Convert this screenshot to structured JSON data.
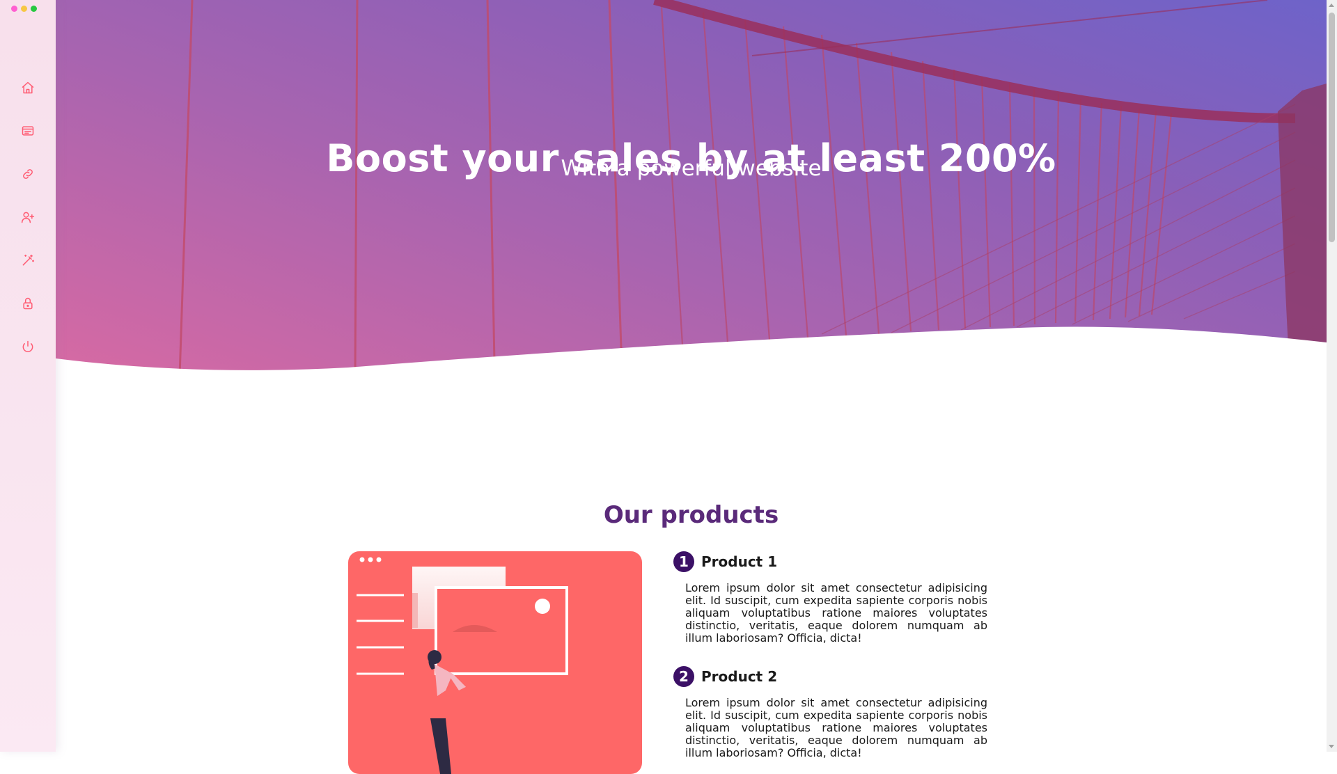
{
  "window": {
    "dot_colors": [
      "#ff5fd1",
      "#f7c744",
      "#28c840"
    ]
  },
  "sidebar": {
    "items": [
      {
        "icon": "home-icon"
      },
      {
        "icon": "browser-card-icon"
      },
      {
        "icon": "link-icon"
      },
      {
        "icon": "user-plus-icon"
      },
      {
        "icon": "magic-wand-icon"
      },
      {
        "icon": "lock-icon"
      },
      {
        "icon": "power-icon"
      }
    ],
    "icon_color": "#ff5c73"
  },
  "hero": {
    "title": "Boost your sales by at least 200%",
    "subtitle": "With a powerful website"
  },
  "products_section": {
    "title": "Our products",
    "items": [
      {
        "number": "1",
        "name": "Product 1",
        "description": "Lorem ipsum dolor sit amet consectetur adipisicing elit. Id suscipit, cum expedita sapiente corporis nobis aliquam voluptatibus ratione maiores voluptates distinctio, veritatis, eaque dolorem numquam ab illum laboriosam? Officia, dicta!"
      },
      {
        "number": "2",
        "name": "Product 2",
        "description": "Lorem ipsum dolor sit amet consectetur adipisicing elit. Id suscipit, cum expedita sapiente corporis nobis aliquam voluptatibus ratione maiores voluptates distinctio, veritatis, eaque dolorem numquam ab illum laboriosam? Officia, dicta!"
      }
    ]
  },
  "colors": {
    "accent_purple": "#5a2a7a",
    "badge_purple": "#3b1066",
    "illustration_coral": "#fe6767"
  }
}
